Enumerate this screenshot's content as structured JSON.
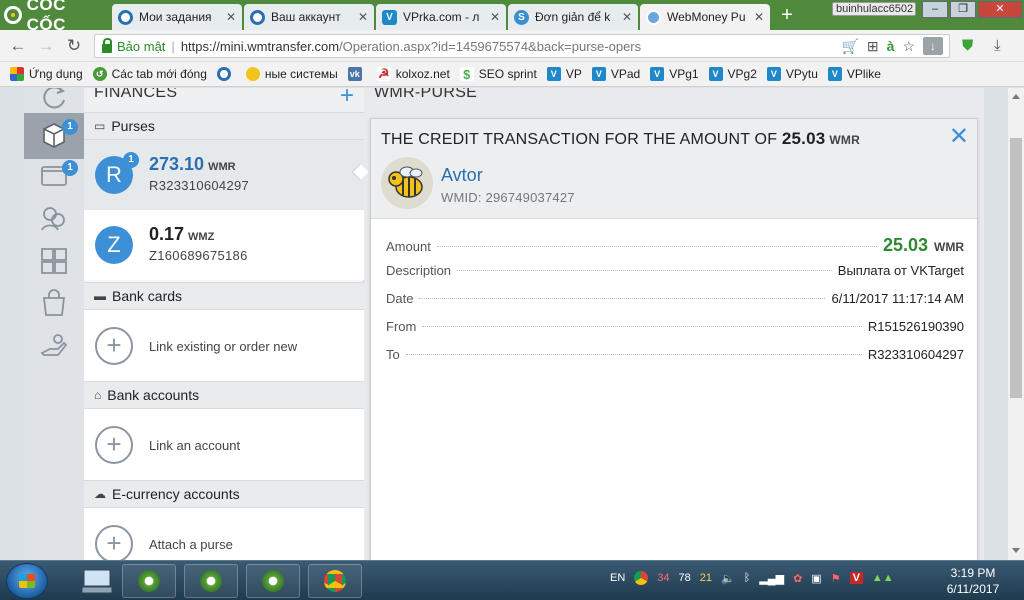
{
  "browser": {
    "brand": "CỐC CỐC",
    "tabs": [
      {
        "title": "Мои задания",
        "icon": "webmoney-icon"
      },
      {
        "title": "Ваш аккаунт",
        "icon": "webmoney-icon"
      },
      {
        "title": "VPrka.com - л",
        "icon": "vprka-icon"
      },
      {
        "title": "Đơn giản để k",
        "icon": "s-icon"
      },
      {
        "title": "WebMoney Pu",
        "icon": "webmoney-icon",
        "active": true
      }
    ],
    "profile": "buinhulacc6502",
    "secure_label": "Bảo mật",
    "url_host": "https://mini.wmtransfer.com",
    "url_rest": "/Operation.aspx?id=1459675574&back=purse-opers",
    "bookmarks": [
      {
        "label": "Ứng dụng",
        "icon": "apps-icon"
      },
      {
        "label": "Các tab mới đóng",
        "icon": "history-icon"
      },
      {
        "label": "",
        "icon": "webmoney-icon"
      },
      {
        "label": "ные системы",
        "icon": "coins-icon"
      },
      {
        "label": "",
        "icon": "vk-icon"
      },
      {
        "label": "kolxoz.net",
        "icon": "hammer-sickle-icon"
      },
      {
        "label": "SEO sprint",
        "icon": "seo-icon"
      },
      {
        "label": "VP",
        "icon": "vprka-icon"
      },
      {
        "label": "VPad",
        "icon": "vprka-icon"
      },
      {
        "label": "VPg1",
        "icon": "vprka-icon"
      },
      {
        "label": "VPg2",
        "icon": "vprka-icon"
      },
      {
        "label": "VPytu",
        "icon": "vprka-icon"
      },
      {
        "label": "VPlike",
        "icon": "vprka-icon"
      }
    ]
  },
  "sidebar": {
    "badges": {
      "purses": "1",
      "wallet": "1"
    }
  },
  "finances": {
    "title": "FINANCES",
    "purses_label": "Purses",
    "purses": [
      {
        "letter": "R",
        "amount": "273.10",
        "currency": "WMR",
        "id": "R323310604297",
        "badge": "1"
      },
      {
        "letter": "Z",
        "amount": "0.17",
        "currency": "WMZ",
        "id": "Z160689675186"
      }
    ],
    "bank_cards_label": "Bank cards",
    "bank_cards_action": "Link existing or order new",
    "bank_accounts_label": "Bank accounts",
    "bank_accounts_action": "Link an account",
    "ecurrency_label": "E-currency accounts",
    "ecurrency_action": "Attach a purse"
  },
  "purse_panel": {
    "title": "WMR-PURSE",
    "transaction": {
      "title_prefix": "THE CREDIT TRANSACTION FOR THE AMOUNT OF",
      "amount": "25.03",
      "currency": "WMR",
      "name": "Avtor",
      "wmid": "WMID: 296749037427",
      "fields": [
        {
          "label": "Amount",
          "value": "25.03",
          "currency": "WMR"
        },
        {
          "label": "Description",
          "value": "Выплата от VKTarget"
        },
        {
          "label": "Date",
          "value": "6/11/2017 11:17:14 AM"
        },
        {
          "label": "From",
          "value": "R151526190390"
        },
        {
          "label": "To",
          "value": "R323310604297"
        }
      ]
    }
  },
  "taskbar": {
    "lang": "EN",
    "tray_numbers": [
      "34",
      "78",
      "21"
    ],
    "time": "3:19 PM",
    "date": "6/11/2017"
  },
  "colors": {
    "accent": "#3d8fd6",
    "amount_green": "#2e8b2e",
    "tab_strip": "#4f8a3c"
  }
}
